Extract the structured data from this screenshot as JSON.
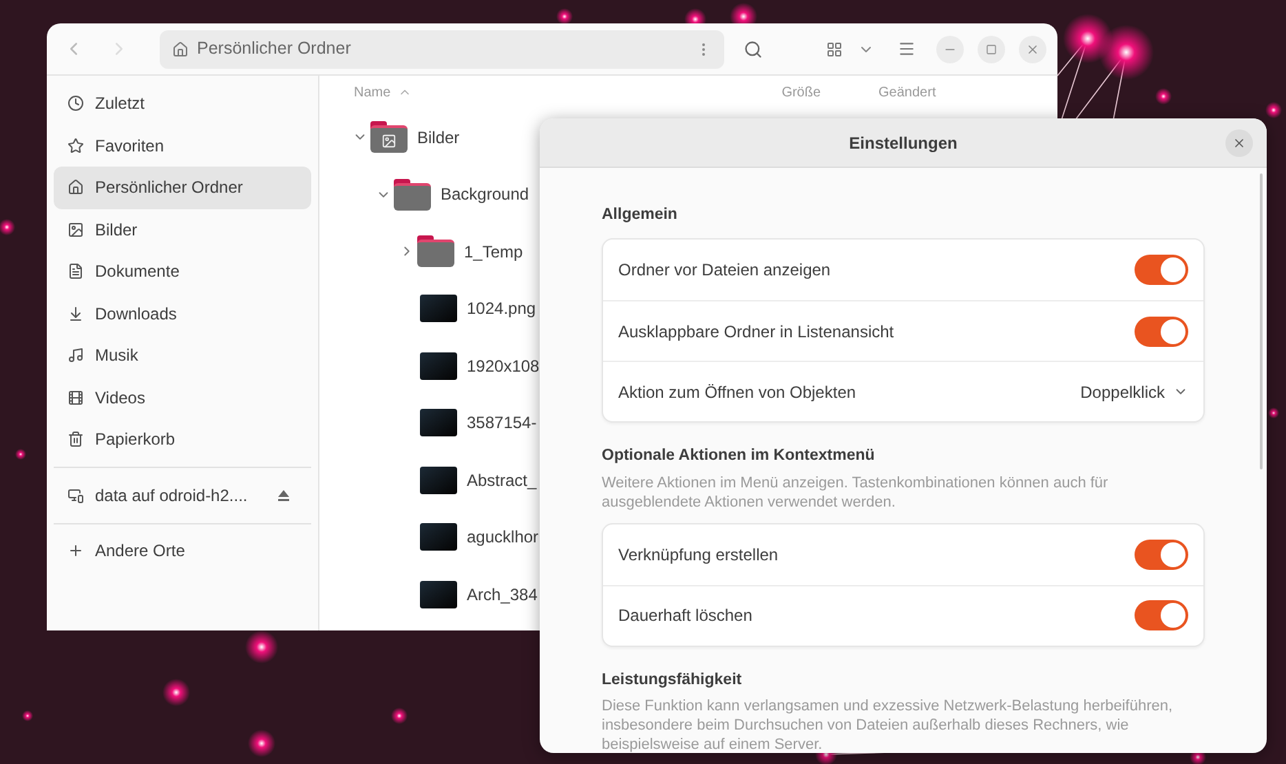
{
  "file_manager": {
    "path": "Persönlicher Ordner",
    "columns": [
      "Name",
      "Größe",
      "Geändert"
    ],
    "sidebar": {
      "items": [
        {
          "label": "Zuletzt",
          "kind": "recent",
          "selected": false
        },
        {
          "label": "Favoriten",
          "kind": "starred",
          "selected": false
        },
        {
          "label": "Persönlicher Ordner",
          "kind": "home",
          "selected": true
        },
        {
          "label": "Bilder",
          "kind": "pictures",
          "selected": false
        },
        {
          "label": "Dokumente",
          "kind": "documents",
          "selected": false
        },
        {
          "label": "Downloads",
          "kind": "downloads",
          "selected": false
        },
        {
          "label": "Musik",
          "kind": "music",
          "selected": false
        },
        {
          "label": "Videos",
          "kind": "videos",
          "selected": false
        },
        {
          "label": "Papierkorb",
          "kind": "trash",
          "selected": false
        }
      ],
      "network": [
        {
          "label": "data auf odroid-h2....",
          "kind": "network"
        }
      ],
      "other": {
        "label": "Andere Orte"
      }
    },
    "tree": [
      {
        "name": "Bilder",
        "kind": "pictures_folder",
        "expanded": true,
        "children": [
          {
            "name": "Background",
            "kind": "folder",
            "expanded": true,
            "children": [
              {
                "name": "1_Temp",
                "kind": "folder",
                "expanded": false
              },
              {
                "name": "1024.png",
                "kind": "image"
              },
              {
                "name": "1920x108",
                "kind": "image"
              },
              {
                "name": "3587154-",
                "kind": "image"
              },
              {
                "name": "Abstract_",
                "kind": "image"
              },
              {
                "name": "agucklhor",
                "kind": "image"
              },
              {
                "name": "Arch_384",
                "kind": "image"
              }
            ]
          }
        ]
      }
    ]
  },
  "dialog": {
    "title": "Einstellungen",
    "sections": [
      {
        "title": "Allgemein",
        "rows": [
          {
            "kind": "switch",
            "label": "Ordner vor Dateien anzeigen",
            "on": true
          },
          {
            "kind": "switch",
            "label": "Ausklappbare Ordner in Listenansicht",
            "on": true
          },
          {
            "kind": "dropdown",
            "label": "Aktion zum Öffnen von Objekten",
            "value": "Doppelklick"
          }
        ]
      },
      {
        "title": "Optionale Aktionen im Kontextmenü",
        "description": "Weitere Aktionen im Menü anzeigen. Tastenkombinationen können auch für ausgeblendete Aktionen verwendet werden.",
        "rows": [
          {
            "kind": "switch",
            "label": "Verknüpfung erstellen",
            "on": true
          },
          {
            "kind": "switch",
            "label": "Dauerhaft löschen",
            "on": true
          }
        ]
      },
      {
        "title": "Leistungsfähigkeit",
        "description": "Diese Funktion kann verlangsamen und exzessive Netzwerk-Belastung herbeiführen, insbesondere beim Durchsuchen von Dateien außerhalb dieses Rechners, wie beispielsweise auf einem Server."
      }
    ]
  }
}
